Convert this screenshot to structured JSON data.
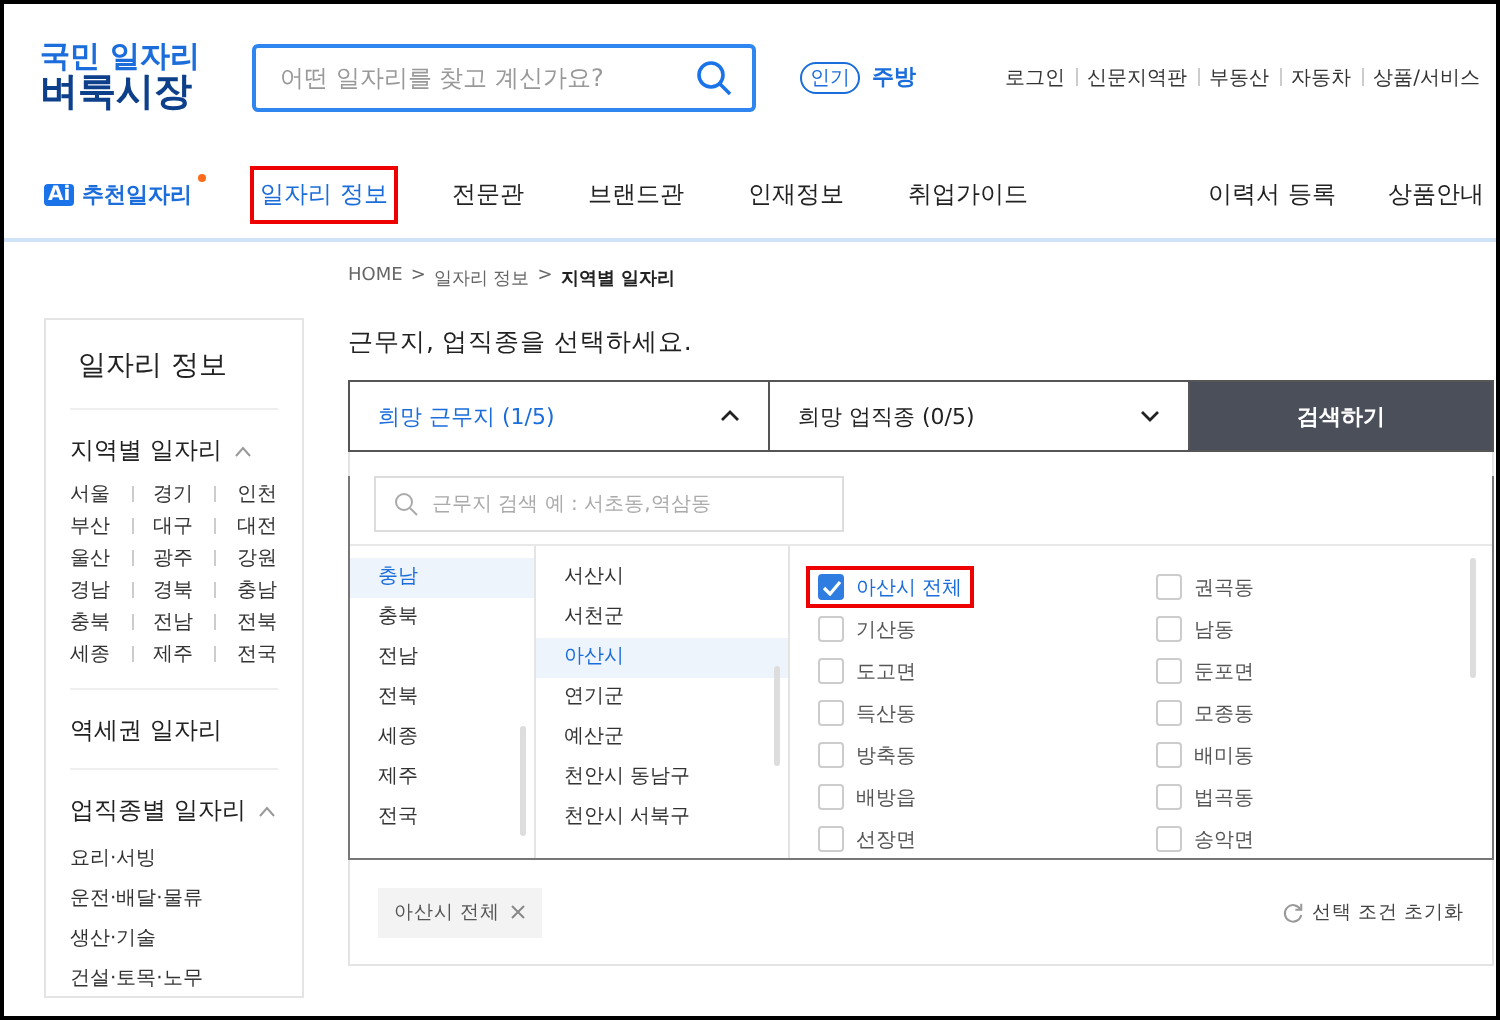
{
  "logo": {
    "line1": "국민 일자리",
    "line2": "벼룩시장"
  },
  "search": {
    "placeholder": "어떤 일자리를 찾고 계신가요?"
  },
  "popular": {
    "badge": "인기",
    "keyword": "주방"
  },
  "top_links": [
    "로그인",
    "신문지역판",
    "부동산",
    "자동차",
    "상품/서비스"
  ],
  "nav": {
    "ai_badge": "Ai",
    "ai_label": "추천일자리",
    "ai_new_dot": true,
    "items": [
      {
        "label": "일자리 정보",
        "selected": true,
        "highlighted": true
      },
      {
        "label": "전문관",
        "selected": false,
        "highlighted": false
      },
      {
        "label": "브랜드관",
        "selected": false,
        "highlighted": false
      },
      {
        "label": "인재정보",
        "selected": false,
        "highlighted": false
      },
      {
        "label": "취업가이드",
        "selected": false,
        "highlighted": false
      }
    ],
    "right_items": [
      "이력서 등록",
      "상품안내"
    ]
  },
  "breadcrumb_separator": ">",
  "breadcrumb": [
    {
      "label": "HOME",
      "current": false
    },
    {
      "label": "일자리 정보",
      "current": false
    },
    {
      "label": "지역별 일자리",
      "current": true
    }
  ],
  "sidebar": {
    "title": "일자리 정보",
    "sections": [
      {
        "kind": "grid",
        "title": "지역별 일자리",
        "expanded": true,
        "links": [
          "서울",
          "경기",
          "인천",
          "부산",
          "대구",
          "대전",
          "울산",
          "광주",
          "강원",
          "경남",
          "경북",
          "충남",
          "충북",
          "전남",
          "전북",
          "세종",
          "제주",
          "전국"
        ]
      },
      {
        "kind": "link",
        "title": "역세권 일자리"
      },
      {
        "kind": "list",
        "title": "업직종별 일자리",
        "expanded": true,
        "links": [
          "요리·서빙",
          "운전·배달·물류",
          "생산·기술",
          "건설·토목·노무"
        ]
      }
    ]
  },
  "main": {
    "heading": "근무지, 업직종을 선택하세요.",
    "tabs": [
      {
        "label": "희망 근무지 (1/5)",
        "selected": true,
        "expanded": true
      },
      {
        "label": "희망 업직종 (0/5)",
        "selected": false,
        "expanded": false
      }
    ],
    "search_button": "검색하기",
    "location_search": {
      "placeholder": "근무지 검색 예 : 서초동,역삼동"
    },
    "regions": [
      {
        "label": "충남",
        "selected": true
      },
      {
        "label": "충북",
        "selected": false
      },
      {
        "label": "전남",
        "selected": false
      },
      {
        "label": "전북",
        "selected": false
      },
      {
        "label": "세종",
        "selected": false
      },
      {
        "label": "제주",
        "selected": false
      },
      {
        "label": "전국",
        "selected": false
      }
    ],
    "cities": [
      {
        "label": "서산시",
        "selected": false
      },
      {
        "label": "서천군",
        "selected": false
      },
      {
        "label": "아산시",
        "selected": true
      },
      {
        "label": "연기군",
        "selected": false
      },
      {
        "label": "예산군",
        "selected": false
      },
      {
        "label": "천안시 동남구",
        "selected": false
      },
      {
        "label": "천안시 서북구",
        "selected": false
      }
    ],
    "districts": [
      {
        "label": "아산시 전체",
        "checked": true,
        "highlighted": true
      },
      {
        "label": "권곡동",
        "checked": false,
        "highlighted": false
      },
      {
        "label": "기산동",
        "checked": false,
        "highlighted": false
      },
      {
        "label": "남동",
        "checked": false,
        "highlighted": false
      },
      {
        "label": "도고면",
        "checked": false,
        "highlighted": false
      },
      {
        "label": "둔포면",
        "checked": false,
        "highlighted": false
      },
      {
        "label": "득산동",
        "checked": false,
        "highlighted": false
      },
      {
        "label": "모종동",
        "checked": false,
        "highlighted": false
      },
      {
        "label": "방축동",
        "checked": false,
        "highlighted": false
      },
      {
        "label": "배미동",
        "checked": false,
        "highlighted": false
      },
      {
        "label": "배방읍",
        "checked": false,
        "highlighted": false
      },
      {
        "label": "법곡동",
        "checked": false,
        "highlighted": false
      },
      {
        "label": "선장면",
        "checked": false,
        "highlighted": false
      },
      {
        "label": "송악면",
        "checked": false,
        "highlighted": false
      }
    ],
    "chips": [
      {
        "label": "아산시 전체"
      }
    ],
    "reset_label": "선택 조건 초기화"
  }
}
